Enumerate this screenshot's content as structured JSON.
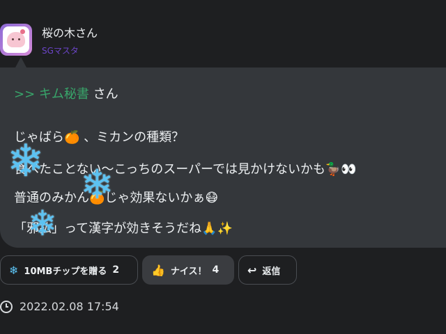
{
  "post": {
    "author": "桜の木さん",
    "rank": "SGマスタ",
    "reply_to": ">> キム秘書",
    "reply_suffix": " さん",
    "lines": [
      "じゃばら🍊 、ミカンの種類？",
      "食べたことない〜こっちのスーパーでは見かけないかも🦆👀",
      "普通のみかん🍊じゃ効果ないかぁ😷",
      "「邪払」って漢字が効きそうだね🙏✨"
    ],
    "timestamp": "2022.02.08 17:54"
  },
  "actions": {
    "gift_label": "10MBチップを贈る",
    "gift_count": "2",
    "nice_label": "ナイス！",
    "nice_count": "4",
    "reply_label": "返信"
  },
  "icons": {
    "gift": "snowflake-icon",
    "nice": "thumbs-up-icon",
    "reply": "reply-arrow-icon",
    "time": "clock-icon"
  },
  "colors": {
    "background": "#1e1f21",
    "bubble": "#34373b",
    "reply_green": "#38a56a",
    "rank_purple": "#6c45c9",
    "snowflake": "#5cc2f2"
  }
}
